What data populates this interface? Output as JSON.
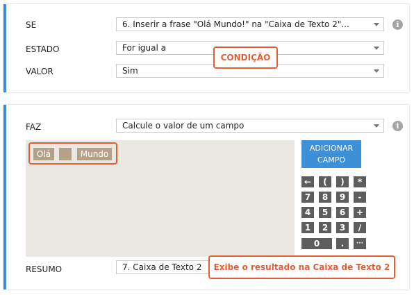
{
  "condition": {
    "se_label": "SE",
    "se_value": "6. Inserir a frase \"Olá Mundo!\" na \"Caixa de Texto 2\"...",
    "estado_label": "ESTADO",
    "estado_value": "For igual a",
    "valor_label": "VALOR",
    "valor_value": "Sim",
    "callout": "CONDIÇÃO"
  },
  "action": {
    "faz_label": "FAZ",
    "faz_value": "Calcule o valor de um campo",
    "tokens": [
      "Olá",
      "",
      "Mundo"
    ],
    "add_field_line1": "ADICIONAR",
    "add_field_line2": "CAMPO",
    "keypad": [
      [
        "←",
        "(",
        ")",
        "*"
      ],
      [
        "7",
        "8",
        "9",
        "-"
      ],
      [
        "4",
        "5",
        "6",
        "+"
      ],
      [
        "1",
        "2",
        "3",
        "/"
      ],
      [
        "0",
        ".",
        "···"
      ]
    ],
    "resumo_label": "RESUMO",
    "resumo_value": "7. Caixa de Texto 2",
    "callout": "Exibe o resultado na Caixa de Texto 2"
  },
  "colors": {
    "accent": "#3b8fd9",
    "callout": "#e45d35",
    "token": "#b5a088",
    "key": "#5d5d5d"
  }
}
